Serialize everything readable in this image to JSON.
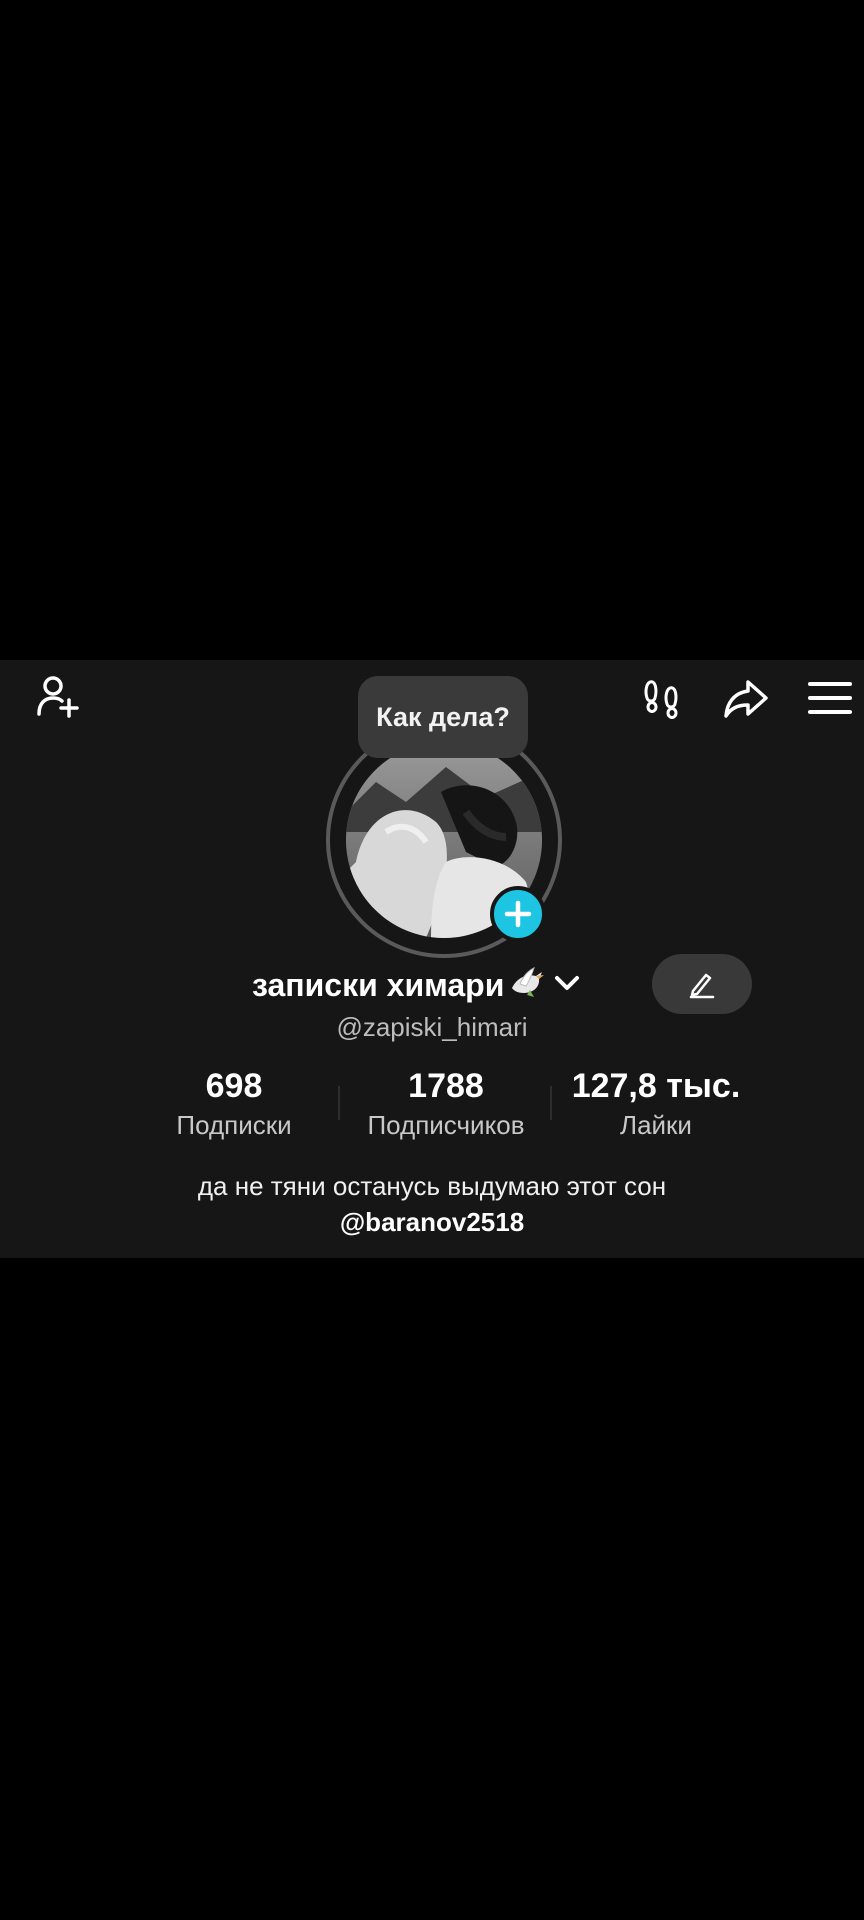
{
  "header": {
    "icons": [
      "add-friend-icon",
      "footprints-icon",
      "share-icon",
      "menu-icon"
    ]
  },
  "profile": {
    "status_bubble": "Как дела?",
    "display_name": "записки химари",
    "name_emoji_icon": "dove-icon",
    "handle": "@zapiski_himari",
    "stats": [
      {
        "value": "698",
        "label": "Подписки"
      },
      {
        "value": "1788",
        "label": "Подписчиков"
      },
      {
        "value": "127,8 тыс.",
        "label": "Лайки"
      }
    ],
    "bio": "да не тяни останусь выдумаю этот сон",
    "bio_mention": "@baranov2518"
  },
  "colors": {
    "background": "#000000",
    "panel": "#161616",
    "accent": "#1ec5e3",
    "button": "#393939"
  }
}
